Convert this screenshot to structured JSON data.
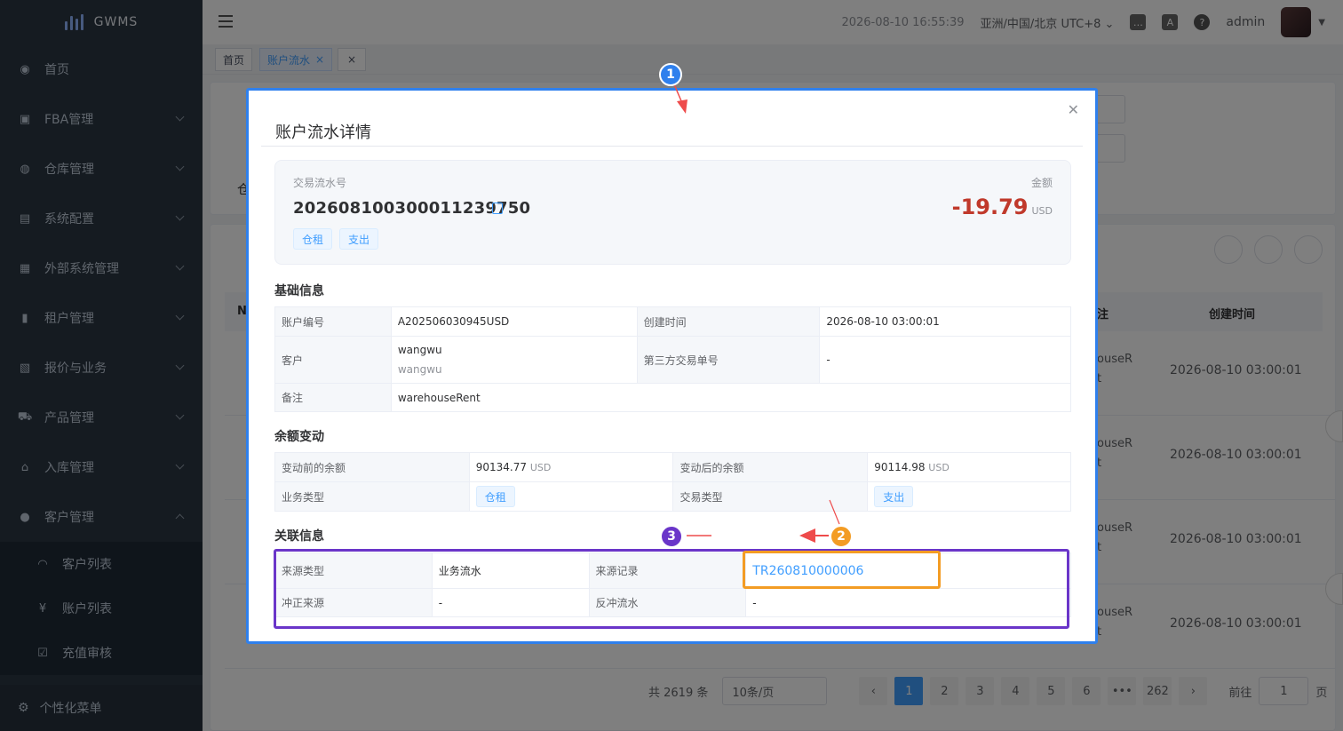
{
  "app": {
    "name": "GWMS"
  },
  "sidebar": {
    "items": [
      {
        "label": "首页",
        "icon": "dashboard-icon",
        "expandable": false
      },
      {
        "label": "FBA管理",
        "icon": "box-icon",
        "expandable": true
      },
      {
        "label": "仓库管理",
        "icon": "globe-icon",
        "expandable": true
      },
      {
        "label": "系统配置",
        "icon": "monitor-icon",
        "expandable": true
      },
      {
        "label": "外部系统管理",
        "icon": "grid-icon",
        "expandable": true
      },
      {
        "label": "租户管理",
        "icon": "bar-chart-icon",
        "expandable": true
      },
      {
        "label": "报价与业务",
        "icon": "document-icon",
        "expandable": true
      },
      {
        "label": "产品管理",
        "icon": "cart-icon",
        "expandable": true
      },
      {
        "label": "入库管理",
        "icon": "home-icon",
        "expandable": true
      },
      {
        "label": "客户管理",
        "icon": "user-icon",
        "expandable": true
      }
    ],
    "customer_sub": [
      {
        "label": "客户列表",
        "icon": "headset-icon"
      },
      {
        "label": "账户列表",
        "icon": "yen-icon"
      },
      {
        "label": "充值审核",
        "icon": "checkbox-icon"
      }
    ],
    "bottom": "个性化菜单"
  },
  "header": {
    "datetime": "2026-08-10 16:55:39",
    "timezone": "亚洲/中国/北京 UTC+8",
    "user": "admin"
  },
  "tags": {
    "home": "首页",
    "active": "账户流水"
  },
  "background": {
    "col_note_tail": "注",
    "col_created": "创建时间",
    "col_n": "N",
    "rows": [
      {
        "note": "ouseR",
        "note2": "t",
        "created": "2026-08-10 03:00:01"
      },
      {
        "note": "ouseR",
        "note2": "t",
        "created": "2026-08-10 03:00:01"
      },
      {
        "note": "ouseR",
        "note2": "t",
        "created": "2026-08-10 03:00:01"
      },
      {
        "note": "ouseR",
        "note2": "t",
        "created": "2026-08-10 03:00:01"
      }
    ],
    "filter_hint": "仓"
  },
  "pager": {
    "total": "共 2619 条",
    "page_size": "10条/页",
    "pages": [
      "1",
      "2",
      "3",
      "4",
      "5",
      "6",
      "•••",
      "262"
    ],
    "goto_label": "前往",
    "goto_value": "1",
    "page_suffix": "页"
  },
  "modal": {
    "title": "账户流水详情",
    "summary": {
      "tx_label": "交易流水号",
      "tx_no": "202608100300011239750",
      "amount_label": "金额",
      "amount": "-19.79",
      "currency": "USD",
      "tags": [
        "仓租",
        "支出"
      ]
    },
    "basic": {
      "title": "基础信息",
      "account_no_k": "账户编号",
      "account_no_v": "A202506030945USD",
      "created_k": "创建时间",
      "created_v": "2026-08-10 03:00:01",
      "customer_k": "客户",
      "customer_v": "wangwu",
      "customer_sub": "wangwu",
      "third_k": "第三方交易单号",
      "third_v": "-",
      "remark_k": "备注",
      "remark_v": "warehouseRent"
    },
    "balance": {
      "title": "余额变动",
      "before_k": "变动前的余额",
      "before_v": "90134.77",
      "before_cur": "USD",
      "after_k": "变动后的余额",
      "after_v": "90114.98",
      "after_cur": "USD",
      "biz_k": "业务类型",
      "biz_v": "仓租",
      "tx_k": "交易类型",
      "tx_v": "支出"
    },
    "related": {
      "title": "关联信息",
      "src_type_k": "来源类型",
      "src_type_v": "业务流水",
      "src_rec_k": "来源记录",
      "src_rec_v": "TR260810000006",
      "correct_k": "冲正来源",
      "correct_v": "-",
      "reverse_k": "反冲流水",
      "reverse_v": "-"
    }
  },
  "annotations": {
    "badge1": "1",
    "badge2": "2",
    "badge3": "3",
    "colors": {
      "blue": "#2f80ed",
      "orange": "#f39c24",
      "purple": "#6a35c9",
      "red": "#ee4b4b"
    }
  }
}
